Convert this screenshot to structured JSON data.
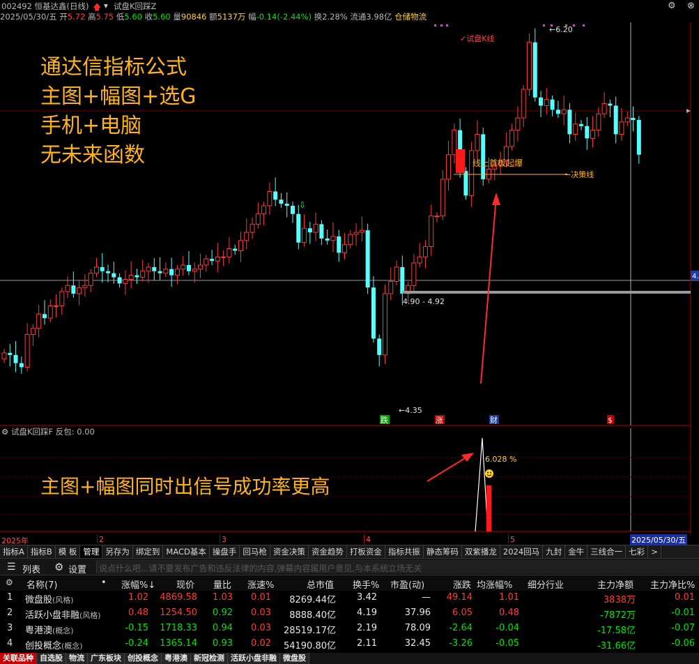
{
  "header": {
    "code_name": "002492 恒基达鑫(日线)",
    "indicator_name": "试盘K回踩Z"
  },
  "info": {
    "date": "2025/05/30/五",
    "open_label": "开",
    "open": "5.72",
    "high_label": "高",
    "high": "5.75",
    "low_label": "低",
    "low": "5.60",
    "close_label": "收",
    "close": "5.60",
    "vol_label": "量",
    "vol": "90846",
    "amt_label": "额",
    "amt": "5137万",
    "chg_label": "幅",
    "chg": "-0.14(-2.44%)",
    "turnover": "换2.28%",
    "float_cap": "流通3.98亿",
    "sector": "仓储物流"
  },
  "chart_labels": {
    "ksline": "试盘K线",
    "peak": "6.20",
    "trough": "4.35",
    "range": "4.90 - 4.92",
    "breakout": "线上首板起爆",
    "decision": "决策线",
    "right_tag": "4.",
    "badge_die": "跌",
    "badge_zhang": "涨",
    "badge_cai": "财",
    "badge_s": "$"
  },
  "promo": {
    "line1": "通达信指标公式",
    "line2": "主图+幅图+选G",
    "line3": "手机+电脑",
    "line4": "无未来函数",
    "sub": "主图+幅图同时出信号成功率更高"
  },
  "sub_chart": {
    "title": "试盘K回踩F",
    "value_label": "反包: 0.00",
    "peak_value": "6.028 %"
  },
  "axis": {
    "year": "2025年",
    "m2": "2",
    "m3": "3",
    "m4": "4",
    "m5": "5",
    "current": "2025/05/30/五"
  },
  "tabs": [
    "指标A",
    "指标B",
    "模 板",
    "管理",
    "另存为",
    "绑定到",
    "MACD基本",
    "操盘手",
    "回马枪",
    "资金决策",
    "资金趋势",
    "打板资金",
    "指标共振",
    "静态筹码",
    "双紫播龙",
    "2024回马",
    "九封",
    "金牛",
    "三线合一",
    "七彩",
    ">"
  ],
  "listbar": {
    "list_label": "列表",
    "settings_label": "设置",
    "comment_placeholder": "说点什么吧...请不要发布广告和违反法律的内容,弹幕内容属用户意见,与本系统立场无关"
  },
  "table": {
    "headers": [
      "名称(7)",
      "•",
      "涨幅%↓",
      "现价",
      "量比",
      "涨速%",
      "总市值",
      "换手%",
      "市盈(动)",
      "涨跌",
      "均涨幅%",
      "细分行业",
      "主力净额",
      "主力净比%"
    ],
    "rows": [
      {
        "idx": "1",
        "name": "微盘股",
        "tag": "(风格)",
        "chg": "1.02",
        "price": "4869.58",
        "vr": "1.03",
        "speed": "0.01",
        "mcap": "8269.44亿",
        "turn": "3.42",
        "pe": "—",
        "diff": "49.14",
        "avg": "1.01",
        "ind": "",
        "net": "3838万",
        "netp": "0.01"
      },
      {
        "idx": "2",
        "name": "活跃小盘非融",
        "tag": "(风格)",
        "chg": "0.48",
        "price": "1254.50",
        "vr": "0.92",
        "speed": "0.03",
        "mcap": "8888.40亿",
        "turn": "4.19",
        "pe": "37.96",
        "diff": "6.05",
        "avg": "0.48",
        "ind": "",
        "net": "-7872万",
        "netp": "-0.01"
      },
      {
        "idx": "3",
        "name": "粤港澳",
        "tag": "(概念)",
        "chg": "-0.15",
        "price": "1718.33",
        "vr": "0.94",
        "speed": "0.03",
        "mcap": "28519.17亿",
        "turn": "2.19",
        "pe": "78.09",
        "diff": "-2.64",
        "avg": "-0.04",
        "ind": "",
        "net": "-17.58亿",
        "netp": "-0.07"
      },
      {
        "idx": "4",
        "name": "创投概念",
        "tag": "(概念)",
        "chg": "-0.24",
        "price": "1365.14",
        "vr": "0.93",
        "speed": "0.02",
        "mcap": "54190.80亿",
        "turn": "2.11",
        "pe": "32.45",
        "diff": "-3.26",
        "avg": "-0.05",
        "ind": "",
        "net": "-31.66亿",
        "netp": "-0.06"
      }
    ]
  },
  "bottom_tabs": [
    "关联品种",
    "自选股",
    "物流",
    "广东板块",
    "创投概念",
    "粤港澳",
    "新冠检测",
    "活跃小盘非融",
    "微盘股"
  ],
  "colors": {
    "up": "#ff3b3b",
    "down": "#54ffff",
    "promo": "#ffb31a",
    "grid": "#8b0000"
  }
}
